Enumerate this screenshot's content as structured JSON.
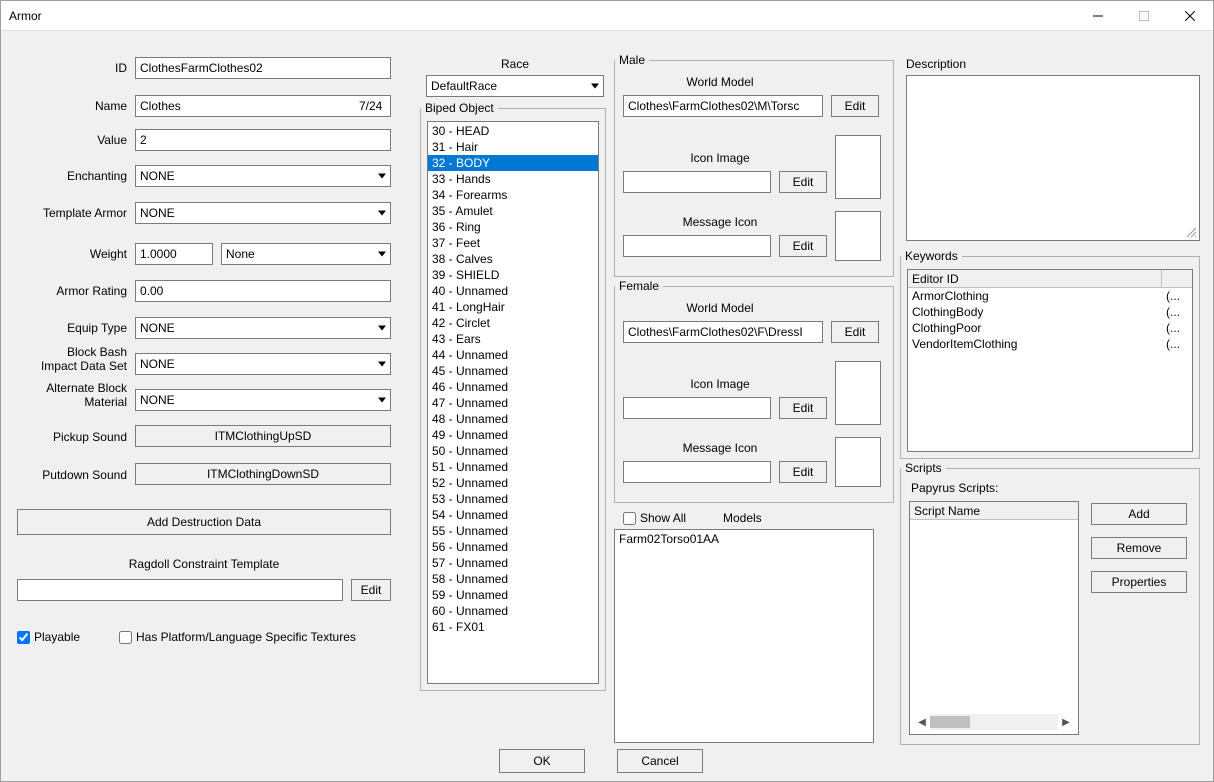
{
  "window": {
    "title": "Armor"
  },
  "left": {
    "id_label": "ID",
    "id_value": "ClothesFarmClothes02",
    "name_label": "Name",
    "name_value": "Clothes",
    "name_counter": "7/24",
    "value_label": "Value",
    "value_value": "2",
    "enchanting_label": "Enchanting",
    "enchanting_value": "NONE",
    "template_armor_label": "Template Armor",
    "template_armor_value": "NONE",
    "weight_label": "Weight",
    "weight_value": "1.0000",
    "weight_type": "None",
    "armor_rating_label": "Armor Rating",
    "armor_rating_value": "0.00",
    "equip_type_label": "Equip Type",
    "equip_type_value": "NONE",
    "block_bash_label": "Block Bash\nImpact Data Set",
    "block_bash_value": "NONE",
    "alt_block_label": "Alternate Block\nMaterial",
    "alt_block_value": "NONE",
    "pickup_sound_label": "Pickup Sound",
    "pickup_sound_btn": "ITMClothingUpSD",
    "putdown_sound_label": "Putdown Sound",
    "putdown_sound_btn": "ITMClothingDownSD",
    "add_destruction_btn": "Add Destruction Data",
    "ragdoll_label": "Ragdoll Constraint Template",
    "ragdoll_value": "",
    "edit_btn": "Edit",
    "playable_label": "Playable",
    "platform_textures_label": "Has Platform/Language Specific Textures"
  },
  "race": {
    "label": "Race",
    "value": "DefaultRace"
  },
  "biped": {
    "legend": "Biped Object",
    "selected_index": 2,
    "items": [
      "30 - HEAD",
      "31 - Hair",
      "32 - BODY",
      "33 - Hands",
      "34 - Forearms",
      "35 - Amulet",
      "36 - Ring",
      "37 - Feet",
      "38 - Calves",
      "39 - SHIELD",
      "40 - Unnamed",
      "41 - LongHair",
      "42 - Circlet",
      "43 - Ears",
      "44 - Unnamed",
      "45 - Unnamed",
      "46 - Unnamed",
      "47 - Unnamed",
      "48 - Unnamed",
      "49 - Unnamed",
      "50 - Unnamed",
      "51 - Unnamed",
      "52 - Unnamed",
      "53 - Unnamed",
      "54 - Unnamed",
      "55 - Unnamed",
      "56 - Unnamed",
      "57 - Unnamed",
      "58 - Unnamed",
      "59 - Unnamed",
      "60 - Unnamed",
      "61 - FX01"
    ]
  },
  "male": {
    "legend": "Male",
    "world_model_label": "World Model",
    "world_model_value": "Clothes\\FarmClothes02\\M\\Torsc",
    "icon_image_label": "Icon Image",
    "icon_image_value": "",
    "message_icon_label": "Message Icon",
    "message_icon_value": "",
    "edit_btn": "Edit"
  },
  "female": {
    "legend": "Female",
    "world_model_label": "World Model",
    "world_model_value": "Clothes\\FarmClothes02\\F\\DressI",
    "icon_image_label": "Icon Image",
    "icon_image_value": "",
    "message_icon_label": "Message Icon",
    "message_icon_value": "",
    "edit_btn": "Edit"
  },
  "models": {
    "show_all_label": "Show All",
    "models_label": "Models",
    "items": [
      "Farm02Torso01AA"
    ]
  },
  "description": {
    "label": "Description",
    "value": ""
  },
  "keywords": {
    "legend": "Keywords",
    "header": "Editor ID",
    "items": [
      {
        "id": "ArmorClothing",
        "extra": "(..."
      },
      {
        "id": "ClothingBody",
        "extra": "(..."
      },
      {
        "id": "ClothingPoor",
        "extra": "(..."
      },
      {
        "id": "VendorItemClothing",
        "extra": "(..."
      }
    ]
  },
  "scripts": {
    "legend": "Scripts",
    "papyrus_label": "Papyrus Scripts:",
    "header": "Script Name",
    "add_btn": "Add",
    "remove_btn": "Remove",
    "properties_btn": "Properties"
  },
  "footer": {
    "ok": "OK",
    "cancel": "Cancel"
  }
}
